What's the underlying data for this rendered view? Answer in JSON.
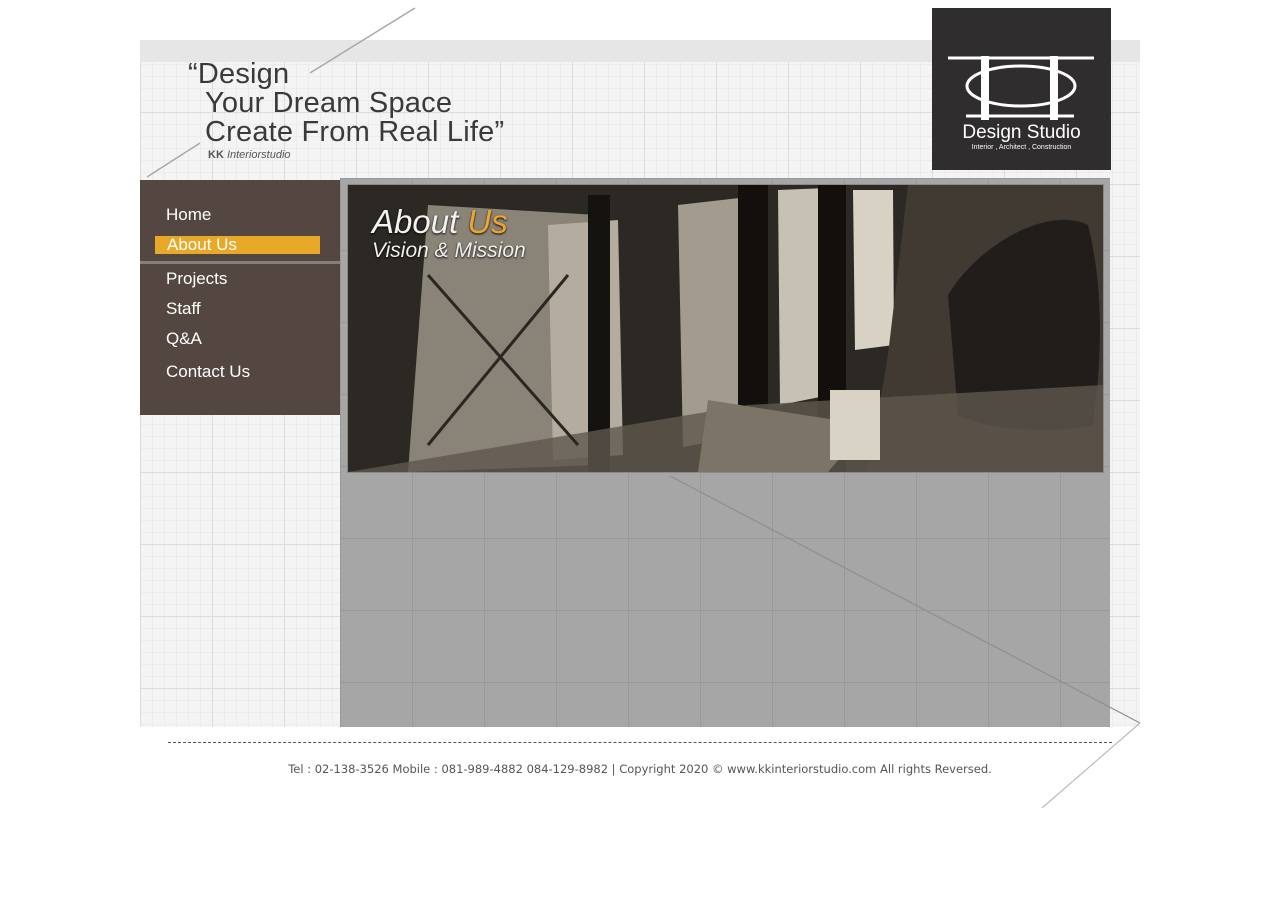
{
  "header": {
    "slogan_line1": "“Design",
    "slogan_line2": "Your Dream Space",
    "slogan_line3": "Create From Real Life”",
    "brand_bold": "KK",
    "brand_rest": " Interiorstudio"
  },
  "logo": {
    "title": "Design Studio",
    "subtitle": "Interior , Architect , Construction"
  },
  "nav": {
    "items": [
      {
        "label": "Home"
      },
      {
        "label": "About Us",
        "active": true
      },
      {
        "label": "Projects"
      },
      {
        "label": "Staff"
      },
      {
        "label": "Q&A"
      },
      {
        "label": "Contact Us"
      }
    ]
  },
  "banner": {
    "title_main": "About ",
    "title_accent": "Us",
    "subtitle": "Vision & Mission"
  },
  "footer": {
    "text": "Tel : 02-138-3526 Mobile : 081-989-4882 084-129-8982   |   Copyright 2020 © www.kkinteriorstudio.com All rights Reversed."
  },
  "colors": {
    "nav_bg": "#544741",
    "active_accent": "#e8a929",
    "logo_bg": "#2f2d2d",
    "main_bg": "#a6a6a6"
  }
}
